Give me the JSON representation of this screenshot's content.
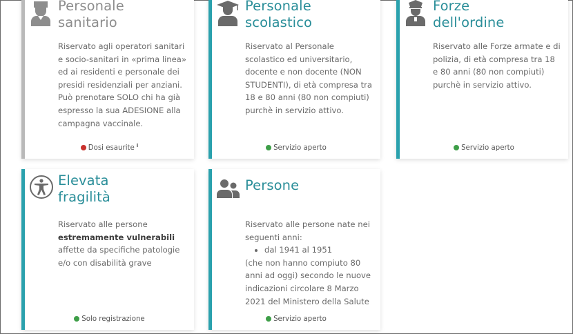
{
  "cards": [
    {
      "title": "Personale\nsanitario",
      "icon": "nurse-icon",
      "description": "Riservato agli operatori sanitari e socio-sanitari in «prima linea» ed ai residenti e personale dei presidi residenziali per anziani. Può prenotare SOLO chi ha già espresso la sua ADESIONE alla campagna vaccinale.",
      "status": "Dosi esaurite",
      "status_color": "#c9312d"
    },
    {
      "title": "Personale\nscolastico",
      "icon": "graduate-icon",
      "description": "Riservato al Personale scolastico ed universitario, docente e non docente (NON STUDENTI), di età compresa tra 18 e 80 anni (80 non compiuti) purchè in servizio attivo.",
      "status": "Servizio aperto",
      "status_color": "#3e9e48"
    },
    {
      "title": "Forze\ndell'ordine",
      "icon": "police-officer-icon",
      "description": "Riservato alle Forze armate e di polizia, di età compresa tra 18 e 80 anni (80 non compiuti) purchè in servizio attivo.",
      "status": "Servizio aperto",
      "status_color": "#3e9e48"
    },
    {
      "title": "Elevata\nfragilità",
      "icon": "accessibility-icon",
      "description_pre": "Riservato alle persone",
      "description_bold": "estremamente vulnerabili",
      "description_post": "affette da specifiche patologie e/o con disabilità grave",
      "status": "Solo registrazione",
      "status_color": "#3e9e48"
    },
    {
      "title": "Persone",
      "icon": "users-icon",
      "description_pre": "Riservato alle persone nate nei seguenti anni:",
      "list_item": "dal 1941 al 1951",
      "description_post": "(che non hanno compiuto 80 anni ad oggi) secondo le nuove indicazioni circolare 8 Marzo 2021 del Ministero della Salute",
      "status": "Servizio aperto",
      "status_color": "#3e9e48"
    }
  ],
  "colors": {
    "accent": "#2aa1ad",
    "title_accent": "#2a8e99",
    "disabled": "#b9b9b9"
  }
}
